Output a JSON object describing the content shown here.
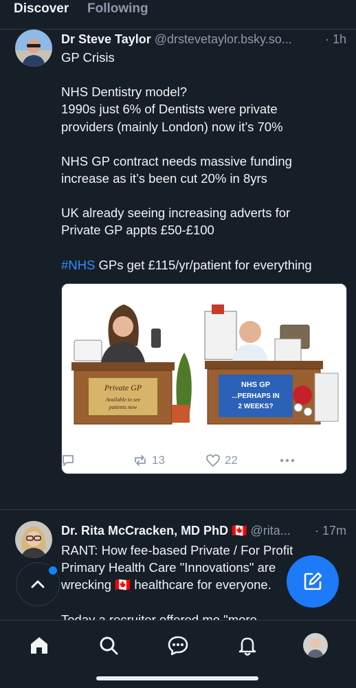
{
  "tabs": [
    {
      "label": "Discover",
      "active": true
    },
    {
      "label": "Following",
      "active": false
    }
  ],
  "posts": [
    {
      "author": {
        "display_name": "Dr Steve Taylor",
        "handle": "@drstevetaylor.bsky.so..."
      },
      "time": "· 1h",
      "text": {
        "line1": "GP Crisis",
        "line2": "NHS Dentistry model?",
        "line3": "1990s just 6% of Dentists were private",
        "line4": "providers (mainly London) now it’s 70%",
        "line5": "NHS GP contract needs massive funding",
        "line6": "increase as it’s been cut 20% in 8yrs",
        "line7": "UK already seeing increasing adverts for",
        "line8": "Private GP appts £50-£100",
        "hashtag": "#NHS",
        "line9_rest": " GPs get £115/yr/patient for everything"
      },
      "image": {
        "left_sign": "Private GP",
        "left_sub1": "Available to see",
        "left_sub2": "patients now",
        "right_sign1": "NHS GP",
        "right_sign2": "...PERHAPS IN",
        "right_sign3": "2 WEEKS?"
      },
      "stats": {
        "replies": "",
        "reposts": "13",
        "likes": "22"
      }
    },
    {
      "author": {
        "display_name": "Dr. Rita McCracken, MD PhD",
        "flag": "🇨🇦",
        "handle": "@rita..."
      },
      "time": "· 17m",
      "text": {
        "line1": "RANT: How fee-based Private / For Profit",
        "line2": "Primary Health Care \"Innovations\" are",
        "line3_a": "wrecking ",
        "line3_flag": "🇨🇦",
        "line3_b": " healthcare for everyone.",
        "line4": "Today a recruiter offered me \"more"
      }
    }
  ],
  "icons": {
    "reply": "speech-bubble-icon",
    "repost": "repost-arrows-icon",
    "like": "heart-icon",
    "more": "ellipsis-icon",
    "compose": "pen-square-icon",
    "scroll_top": "chevron-up-icon",
    "nav": [
      "home-icon",
      "search-icon",
      "chat-icon",
      "bell-icon",
      "profile-avatar"
    ]
  },
  "colors": {
    "background": "#161e27",
    "accent": "#1d7af8",
    "hashtag": "#2f8dfc",
    "muted_text": "#8d9aaa"
  }
}
